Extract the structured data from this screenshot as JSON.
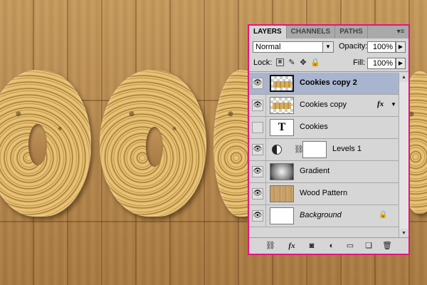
{
  "panel": {
    "tabs": [
      "LAYERS",
      "CHANNELS",
      "PATHS"
    ],
    "active_tab": "LAYERS",
    "menu_icon": "panel-menu-icon",
    "blend_mode": "Normal",
    "opacity_label": "Opacity:",
    "opacity_value": "100%",
    "lock_label": "Lock:",
    "fill_label": "Fill:",
    "fill_value": "100%",
    "accent_border_color": "#e4147d",
    "selected_row_color": "#a9b4cf"
  },
  "layers": [
    {
      "name": "Cookies copy 2",
      "visible": true,
      "selected": true,
      "thumb": "cookie-text-thumbnail",
      "style": "bold"
    },
    {
      "name": "Cookies copy",
      "visible": true,
      "selected": false,
      "thumb": "cookie-text-thumbnail",
      "fx": "fx"
    },
    {
      "name": "Cookies",
      "visible": false,
      "selected": false,
      "thumb": "type-layer-thumbnail",
      "thumb_text": "T"
    },
    {
      "name": "Levels 1",
      "visible": true,
      "selected": false,
      "thumb": "levels-adjustment-icon"
    },
    {
      "name": "Gradient",
      "visible": true,
      "selected": false,
      "thumb": "gradient-thumbnail"
    },
    {
      "name": "Wood Pattern",
      "visible": true,
      "selected": false,
      "thumb": "wood-thumbnail"
    },
    {
      "name": "Background",
      "visible": true,
      "selected": false,
      "thumb": "white-thumbnail",
      "style": "italic",
      "locked": true
    }
  ],
  "footer_icons": [
    "link-layers-icon",
    "add-style-icon",
    "add-mask-icon",
    "adjustment-layer-icon",
    "new-group-icon",
    "new-layer-icon",
    "delete-layer-icon"
  ],
  "footer_glyphs": [
    "⛓",
    "fx",
    "◙",
    "◐",
    "▭",
    "❏",
    "🗑"
  ]
}
